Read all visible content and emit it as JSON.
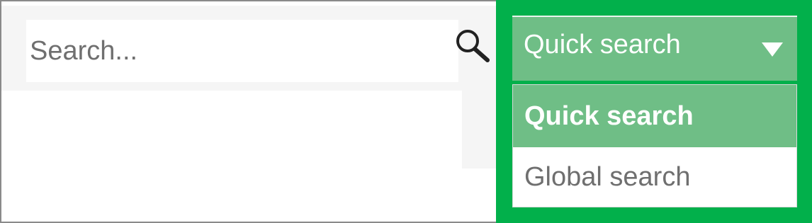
{
  "search": {
    "placeholder": "Search...",
    "value": "",
    "icon": "search-icon"
  },
  "scope_dropdown": {
    "selected_label": "Quick search",
    "caret_icon": "caret-down-icon",
    "options": [
      {
        "label": "Quick search",
        "selected": true
      },
      {
        "label": "Global search",
        "selected": false
      }
    ],
    "expanded": true
  },
  "colors": {
    "highlight": "#02b04b",
    "dropdown_fill": "#6fbe86",
    "option_text": "#6f6f6f",
    "panel_gray": "#f5f5f5",
    "frame_border": "#8a8a8a"
  }
}
